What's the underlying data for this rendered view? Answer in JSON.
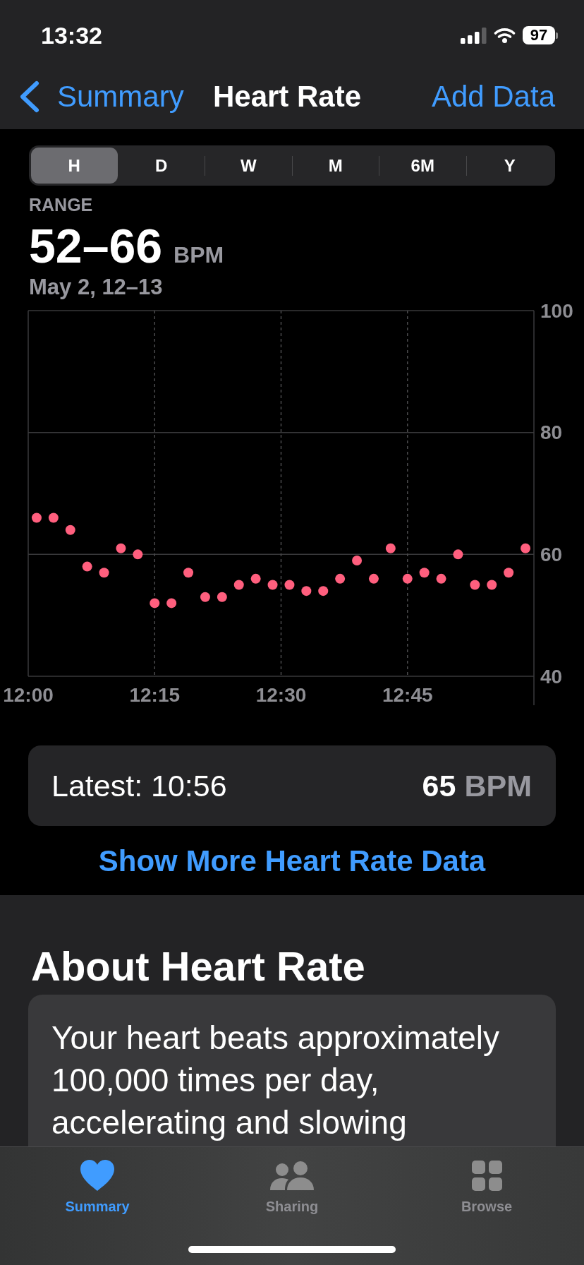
{
  "status_bar": {
    "time": "13:32",
    "battery": "97"
  },
  "nav_bar": {
    "back": "Summary",
    "title": "Heart Rate",
    "action": "Add Data"
  },
  "range_tabs": [
    {
      "label": "H",
      "selected": true
    },
    {
      "label": "D",
      "selected": false
    },
    {
      "label": "W",
      "selected": false
    },
    {
      "label": "M",
      "selected": false
    },
    {
      "label": "6M",
      "selected": false
    },
    {
      "label": "Y",
      "selected": false
    }
  ],
  "summary": {
    "label": "RANGE",
    "value": "52–66",
    "unit": "BPM",
    "date": "May 2, 12–13"
  },
  "chart": {
    "chart_data": {
      "type": "scatter",
      "grid": true,
      "categories": [
        "12:00",
        null,
        null,
        null,
        null,
        null,
        null,
        null,
        null,
        null,
        null,
        null,
        null,
        null,
        null,
        "12:15",
        null,
        null,
        null,
        null,
        null,
        null,
        null,
        null,
        null,
        null,
        null,
        null,
        null,
        null,
        "12:30",
        null,
        null,
        null,
        null,
        null,
        null,
        null,
        null,
        null,
        null,
        null,
        null,
        null,
        null,
        "12:45",
        null,
        null,
        null,
        null,
        null,
        null,
        null,
        null,
        null,
        null,
        null,
        null,
        null,
        null
      ],
      "series": [
        {
          "color": "#ff5f7e",
          "values": [
            null,
            66,
            null,
            66,
            null,
            64,
            null,
            58,
            null,
            57,
            null,
            61,
            null,
            60,
            null,
            52,
            null,
            52,
            null,
            57,
            null,
            53,
            null,
            53,
            null,
            55,
            null,
            56,
            null,
            55,
            null,
            55,
            null,
            54,
            null,
            54,
            null,
            56,
            null,
            59,
            null,
            56,
            null,
            61,
            null,
            56,
            null,
            57,
            null,
            56,
            null,
            60,
            null,
            55,
            null,
            55,
            null,
            57,
            null,
            61
          ]
        }
      ],
      "ylim": [
        40,
        100
      ],
      "yticks": [
        40,
        60,
        80,
        100
      ]
    }
  },
  "latest": {
    "label": "Latest: 10:56",
    "value": "65",
    "unit": "BPM"
  },
  "more_link": "Show More Heart Rate Data",
  "about": {
    "title": "About Heart Rate",
    "text": "Your heart beats approximately 100,000 times per day, accelerating and slowing"
  },
  "tab_bar": [
    {
      "label": "Summary",
      "selected": true
    },
    {
      "label": "Sharing",
      "selected": false
    },
    {
      "label": "Browse",
      "selected": false
    }
  ]
}
